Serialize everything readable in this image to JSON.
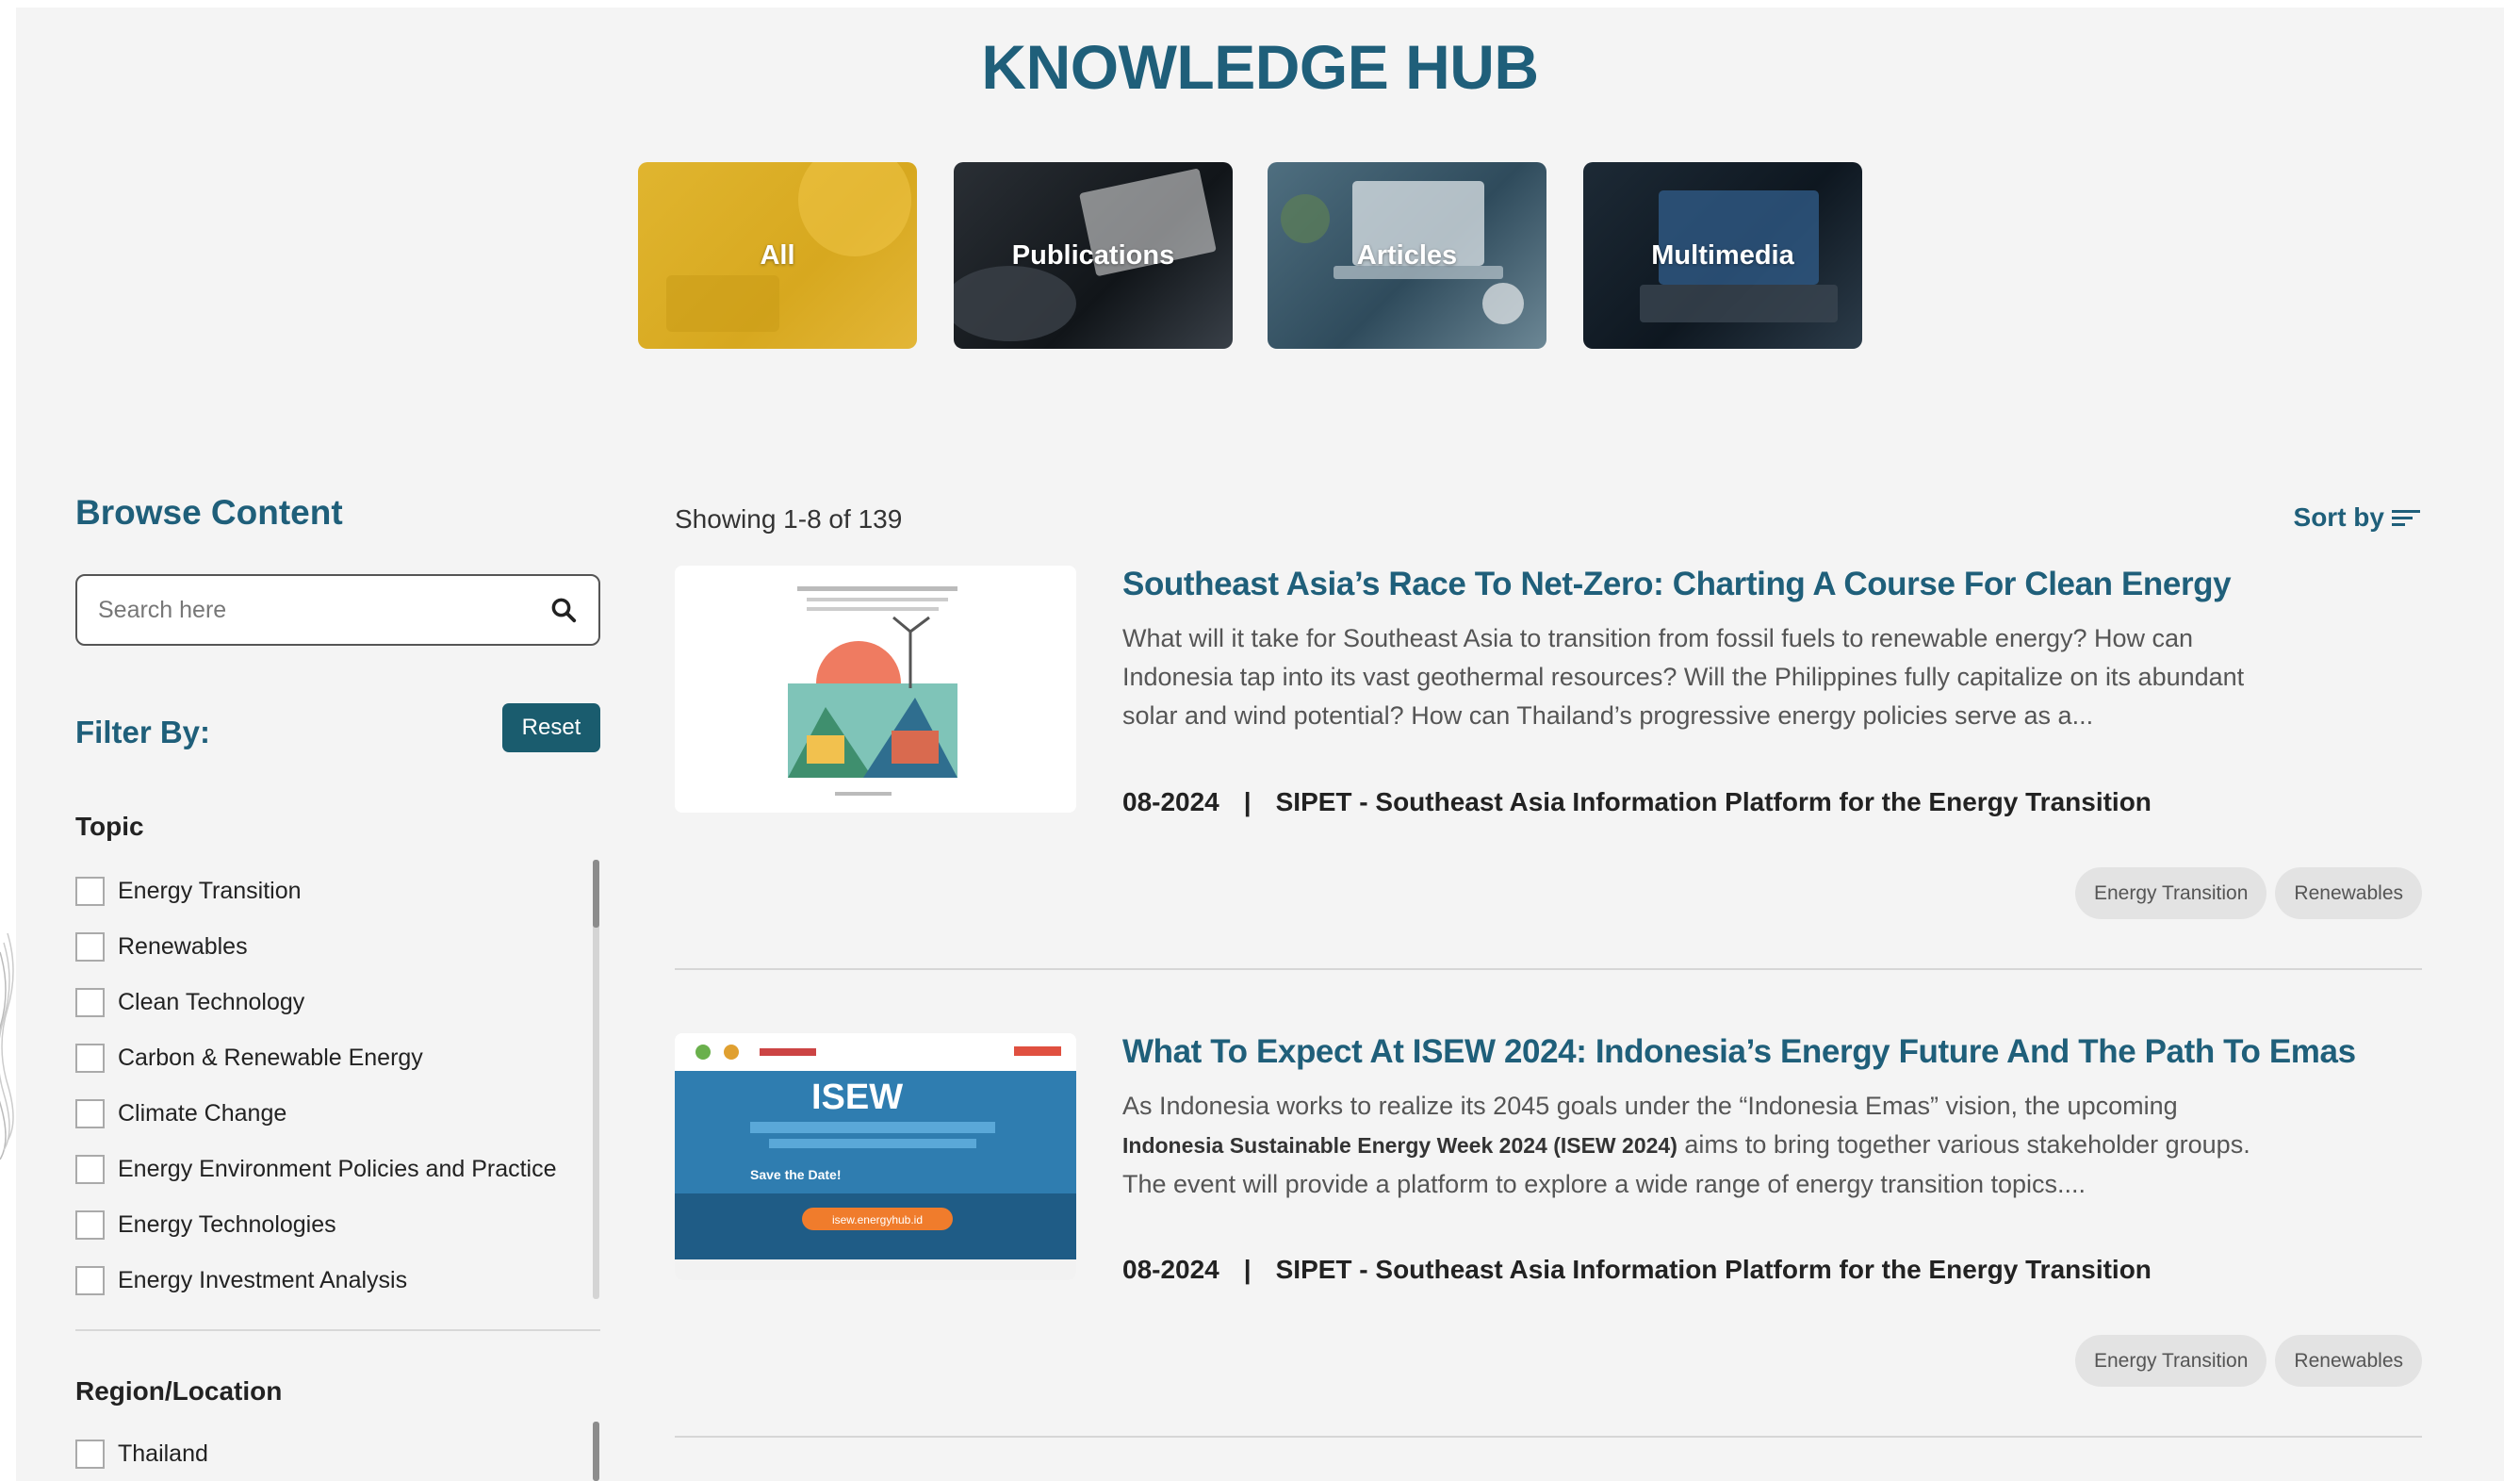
{
  "hub": {
    "title": "KNOWLEDGE HUB"
  },
  "categories": [
    {
      "label": "All",
      "color": "#dbae27"
    },
    {
      "label": "Publications",
      "color": "#1b2026"
    },
    {
      "label": "Articles",
      "color": "#3f5d6e"
    },
    {
      "label": "Multimedia",
      "color": "#16222d"
    }
  ],
  "sidebar": {
    "browse_title": "Browse Content",
    "search": {
      "placeholder": "Search here",
      "value": ""
    },
    "filter_label": "Filter By:",
    "reset_label": "Reset",
    "topic": {
      "title": "Topic",
      "items": [
        "Energy Transition",
        "Renewables",
        "Clean Technology",
        "Carbon & Renewable Energy",
        "Climate Change",
        "Energy Environment Policies and Practice",
        "Energy Technologies",
        "Energy Investment Analysis"
      ]
    },
    "region": {
      "title": "Region/Location",
      "items": [
        "Thailand"
      ]
    }
  },
  "results": {
    "showing": "Showing 1-8 of 139",
    "sort_label": "Sort by",
    "items": [
      {
        "title": "Southeast Asia’s Race To Net-Zero: Charting A Course For Clean Energy",
        "desc": "What will it take for Southeast Asia to transition from fossil fuels to renewable energy? How can Indonesia tap into its vast geothermal resources? Will the Philippines fully capitalize on its abundant solar and wind potential? How can Thailand’s progressive energy policies serve as a...",
        "date": "08-2024",
        "source": "SIPET - Southeast Asia Information Platform for the Energy Transition",
        "tags": [
          "Energy Transition",
          "Renewables"
        ]
      },
      {
        "title": "What To Expect At ISEW 2024: Indonesia’s Energy Future And The Path To Emas",
        "desc_pre": "As Indonesia works to realize its 2045 goals under the “Indonesia Emas” vision, the upcoming ",
        "desc_strong": "Indonesia Sustainable Energy Week 2024 (ISEW 2024)",
        "desc_post": " aims to bring together various stakeholder groups. The event will provide a platform to explore a wide range of energy transition topics....",
        "date": "08-2024",
        "source": "SIPET - Southeast Asia Information Platform for the Energy Transition",
        "tags": [
          "Energy Transition",
          "Renewables"
        ],
        "thumb_text": "ISEW",
        "thumb_cta": "Save the Date!",
        "thumb_url": "isew.energyhub.id"
      }
    ]
  },
  "colors": {
    "brand": "#1f5f7a",
    "reset_button": "#1a5c6e",
    "tag_bg": "#e3e3e3",
    "page_bg": "#f4f4f4"
  },
  "icons": {
    "search": "search-icon",
    "sort": "sort-lines-icon"
  }
}
